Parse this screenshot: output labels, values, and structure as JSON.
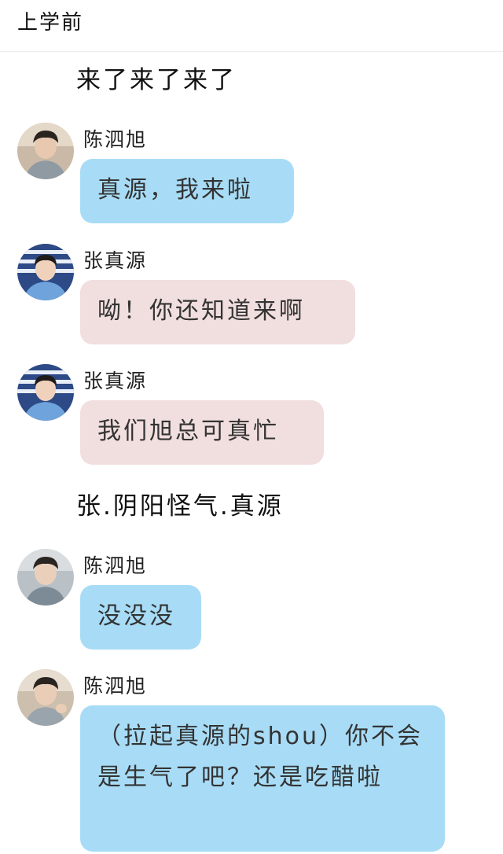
{
  "header": {
    "title": "上学前"
  },
  "narrations": [
    "来了来了来了",
    "张.阴阳怪气.真源"
  ],
  "messages": [
    {
      "sender": "陈泗旭",
      "text": "真源，我来啦",
      "color": "blue"
    },
    {
      "sender": "张真源",
      "text": "呦！你还知道来啊",
      "color": "pink"
    },
    {
      "sender": "张真源",
      "text": "我们旭总可真忙",
      "color": "pink"
    },
    {
      "sender": "陈泗旭",
      "text": "没没没",
      "color": "blue"
    },
    {
      "sender": "陈泗旭",
      "text": "（拉起真源的shou）你不会是生气了吧？还是吃醋啦",
      "color": "blue"
    }
  ],
  "theme": {
    "blue_bubble": "#a8dcf6",
    "pink_bubble": "#f1dede"
  }
}
